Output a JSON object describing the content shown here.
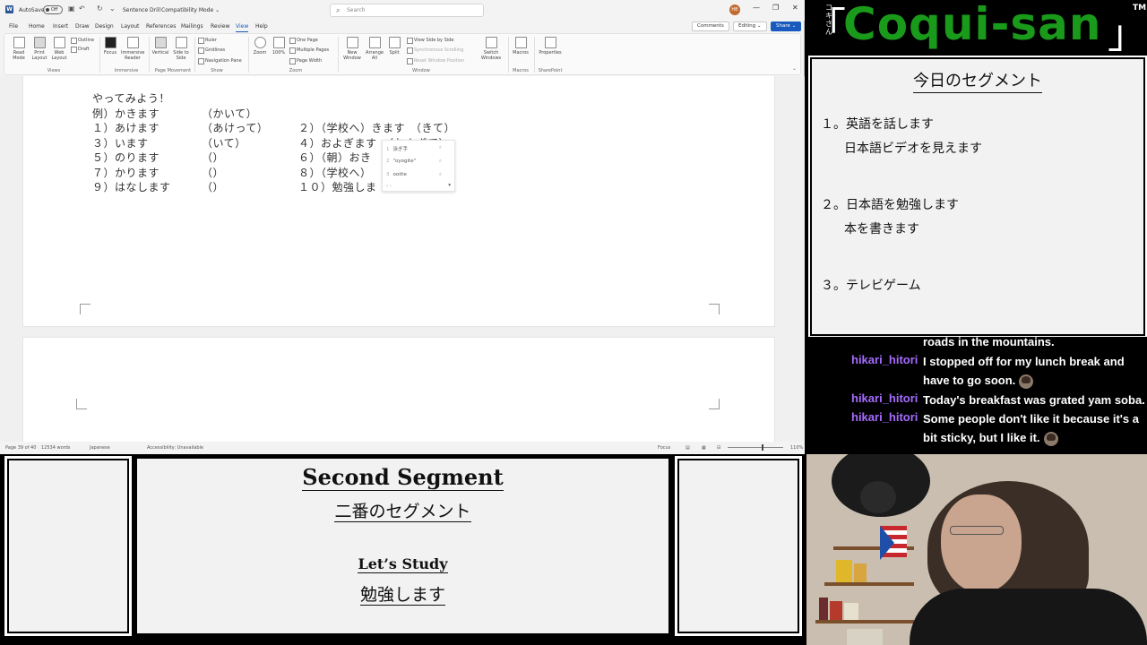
{
  "word": {
    "titlebar": {
      "logo": "W",
      "autosave_label": "AutoSave",
      "autosave_state": "Off",
      "doc_title": "Sentence Drill",
      "compat": "Compatibility Mode ⌄",
      "search_placeholder": "Search",
      "avatar_initials": "HB"
    },
    "menu": {
      "tabs": [
        "File",
        "Home",
        "Insert",
        "Draw",
        "Design",
        "Layout",
        "References",
        "Mailings",
        "Review",
        "View",
        "Help"
      ],
      "active_tab": "View",
      "comments": "Comments",
      "editing": "Editing ⌄",
      "share": "Share ⌄"
    },
    "ribbon": {
      "read_mode": "Read Mode",
      "print_layout": "Print Layout",
      "web_layout": "Web Layout",
      "outline": "Outline",
      "draft": "Draft",
      "views_group": "Views",
      "focus": "Focus",
      "immersive_reader": "Immersive Reader",
      "immersive_group": "Immersive",
      "vertical": "Vertical",
      "side_to_side": "Side to Side",
      "page_movement_group": "Page Movement",
      "ruler": "Ruler",
      "gridlines": "Gridlines",
      "navigation_pane": "Navigation Pane",
      "show_group": "Show",
      "zoom": "Zoom",
      "zoom_100": "100%",
      "one_page": "One Page",
      "multiple_pages": "Multiple Pages",
      "page_width": "Page Width",
      "zoom_group": "Zoom",
      "new_window": "New Window",
      "arrange_all": "Arrange All",
      "split": "Split",
      "view_side_by_side": "View Side by Side",
      "sync_scrolling": "Synchronous Scrolling",
      "reset_window": "Reset Window Position",
      "switch_windows": "Switch Windows",
      "window_group": "Window",
      "macros": "Macros",
      "macros_group": "Macros",
      "properties": "Properties",
      "sharepoint_group": "SharePoint"
    },
    "document": {
      "heading": "やってみよう！",
      "rows": [
        {
          "left": "例）かきます",
          "left_answer": "（かいて）",
          "right": "",
          "right_answer": ""
        },
        {
          "left": "１）あけます",
          "left_answer": "（あけって）",
          "right": "２）（学校へ）きます",
          "right_answer": "（きて）"
        },
        {
          "left": "３）います",
          "left_answer": "（いて）",
          "right": "４）およぎます",
          "right_answer": "（およぎて）"
        },
        {
          "left": "５）のります",
          "left_answer": "（）",
          "right": "６）（朝）おき",
          "right_answer": ""
        },
        {
          "left": "７）かります",
          "left_answer": "（）",
          "right": "８）（学校へ）",
          "right_answer": ""
        },
        {
          "left": "９）はなします",
          "left_answer": "（）",
          "right": "１０）勉強しま",
          "right_answer": ""
        }
      ],
      "autocomplete": [
        {
          "num": "1",
          "text": "泳ぎ手"
        },
        {
          "num": "2",
          "text": "\"oyogite\""
        },
        {
          "num": "3",
          "text": "ooiite"
        }
      ]
    },
    "status": {
      "page": "Page 39 of 40",
      "words": "12534 words",
      "language": "Japanese",
      "accessibility": "Accessibility: Unavailable",
      "focus": "Focus",
      "zoom": "110%"
    }
  },
  "banner": {
    "kana": "コキさん",
    "title": "Coqui-san",
    "tm": "TM",
    "open_bracket": "「",
    "close_bracket": "」",
    "title_color": "#1a9a1a"
  },
  "segments": {
    "title": "今日のセグメント",
    "lines": [
      "１。英語を話します",
      "日本語ビデオを見えます",
      "２。日本語を勉強します",
      "本を書きます",
      "３。テレビゲーム"
    ]
  },
  "chat": {
    "user_color": "#a66bff",
    "messages": [
      {
        "user": "",
        "text": "roads in the mountains.",
        "emote": false
      },
      {
        "user": "hikari_hitori",
        "text": "I stopped off for my lunch break and have to go soon.",
        "emote": true
      },
      {
        "user": "hikari_hitori",
        "text": "Today's breakfast was grated yam soba.",
        "emote": false
      },
      {
        "user": "hikari_hitori",
        "text": "Some people don't like it because it's a bit sticky, but I like it.",
        "emote": true
      }
    ]
  },
  "lower": {
    "title": "Second Segment",
    "subtitle": "二番のセグメント",
    "heading": "Let’s Study",
    "heading_jp": "勉強します"
  }
}
